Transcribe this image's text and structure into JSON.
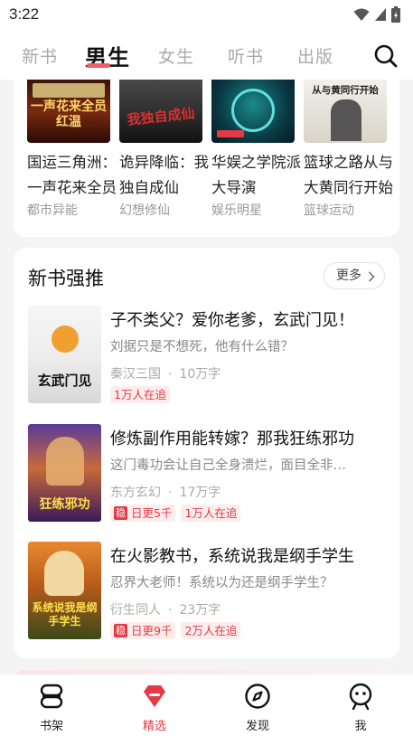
{
  "status": {
    "time": "3:22"
  },
  "tabs": [
    {
      "label": "新书"
    },
    {
      "label": "男生"
    },
    {
      "label": "女生"
    },
    {
      "label": "听书"
    },
    {
      "label": "出版"
    }
  ],
  "grid_books": [
    {
      "title": "国运三角洲：一声花来全员红温",
      "category": "都市异能",
      "cover_text": "一声花来全员红温"
    },
    {
      "title": "诡异降临：我独自成仙",
      "category": "幻想修仙",
      "cover_text": "我独自成仙"
    },
    {
      "title": "华娱之学院派大导演",
      "category": "娱乐明星",
      "cover_text": ""
    },
    {
      "title": "篮球之路从与大黄同行开始",
      "category": "篮球运动",
      "cover_text": "从与黄同行开始"
    }
  ],
  "recommend": {
    "title": "新书强推",
    "more_label": "更多",
    "books": [
      {
        "title": "子不类父？爱你老爹，玄武门见！",
        "desc": "刘据只是不想死，他有什么错？",
        "category": "秦汉三国",
        "words": "10万字",
        "update_tag": "",
        "follow_tag": "1万人在追",
        "cover_text": "玄武门见"
      },
      {
        "title": "修炼副作用能转嫁？那我狂练邪功",
        "desc": "这门毒功会让自己全身溃烂，面目全非…",
        "category": "东方玄幻",
        "words": "17万字",
        "update_tag": "日更5千",
        "follow_tag": "1万人在追",
        "cover_text": "狂练邪功"
      },
      {
        "title": "在火影教书，系统说我是纲手学生",
        "desc": "忍界大老师！系统以为还是纲手学生？",
        "category": "衍生同人",
        "words": "23万字",
        "update_tag": "日更9千",
        "follow_tag": "2万人在追",
        "cover_text": "系统说我是纲手学生"
      }
    ]
  },
  "update_badge": "稳",
  "bottom_nav": [
    {
      "label": "书架",
      "icon": "bookshelf-icon"
    },
    {
      "label": "精选",
      "icon": "featured-icon"
    },
    {
      "label": "发现",
      "icon": "compass-icon"
    },
    {
      "label": "我",
      "icon": "profile-icon"
    }
  ],
  "colors": {
    "accent": "#e53a44",
    "tab_underline": "#f25b63"
  }
}
